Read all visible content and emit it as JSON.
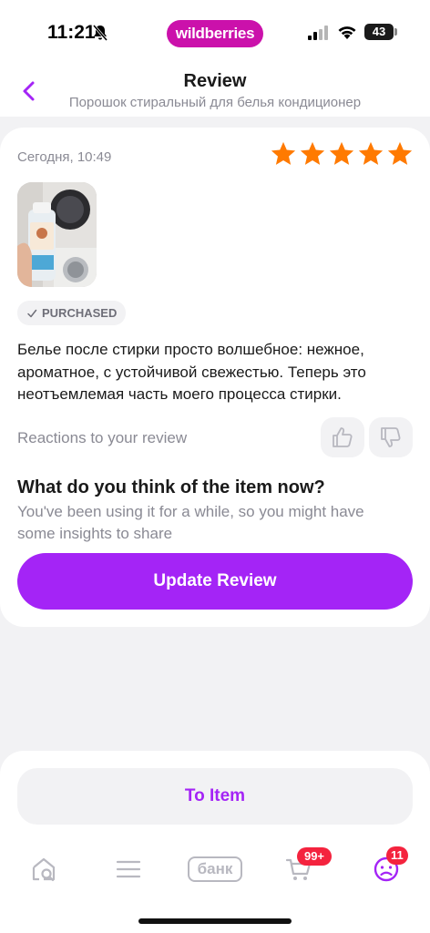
{
  "status_bar": {
    "time": "11:21",
    "brand": "wildberries",
    "battery": "43",
    "icons": [
      "bell-muted-icon",
      "cellular-signal-icon",
      "wifi-icon",
      "battery-icon"
    ]
  },
  "header": {
    "title": "Review",
    "subtitle": "Порошок стиральный для белья кондиционер",
    "back_icon": "chevron-left-icon"
  },
  "review": {
    "date": "Сегодня, 10:49",
    "rating": 5,
    "max_rating": 5,
    "badge": "PURCHASED",
    "text": "Белье после стирки просто волшебное: нежное, ароматное, с устойчивой свежестью. Теперь это неотъемлемая часть моего процесса стирки.",
    "reactions_label": "Reactions to your review"
  },
  "prompt": {
    "title": "What do you think of the item now?",
    "subtitle": "You've been using it for a while, so you might have some insights to share",
    "button": "Update Review"
  },
  "actions": {
    "to_item": "To Item"
  },
  "tabbar": {
    "bank_label": "банк",
    "cart_count": "99+",
    "profile_count": "11",
    "icons": [
      "home-search-icon",
      "catalog-menu-icon",
      "bank-icon",
      "cart-icon",
      "profile-icon"
    ]
  },
  "colors": {
    "brand": "#cb11ab",
    "accent": "#a424f6",
    "star": "#ff7a00",
    "counter": "#f4233e"
  }
}
